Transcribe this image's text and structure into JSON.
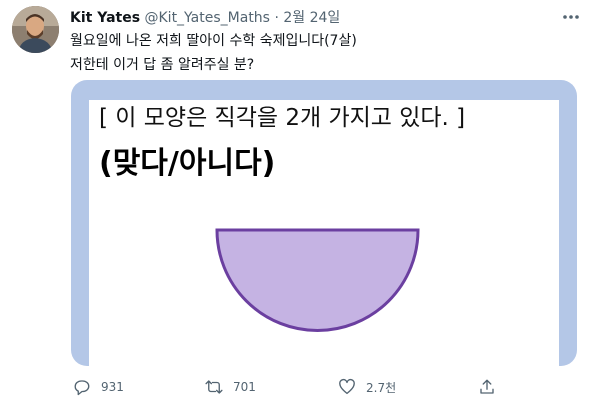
{
  "tweet": {
    "author_name": "Kit Yates",
    "author_handle": "@Kit_Yates_Maths",
    "separator": "·",
    "date": "2월 24일",
    "text_line1": "월요일에 나온 저희 딸아이 수학 숙제입니다(7살)",
    "text_line2": "저한테 이거 답 좀 알려주실 분?"
  },
  "media": {
    "question_line1": "[ 이 모양은 직각을 2개 가지고 있다. ]",
    "question_line2": "(맞다/아니다)",
    "shape": {
      "fill_color": "#c5b3e3",
      "stroke_color": "#6b3fa0"
    }
  },
  "actions": {
    "replies": "931",
    "retweets": "701",
    "likes": "2.7천"
  },
  "colors": {
    "secondary_text": "#536471",
    "media_frame": "#b4c7e7"
  }
}
